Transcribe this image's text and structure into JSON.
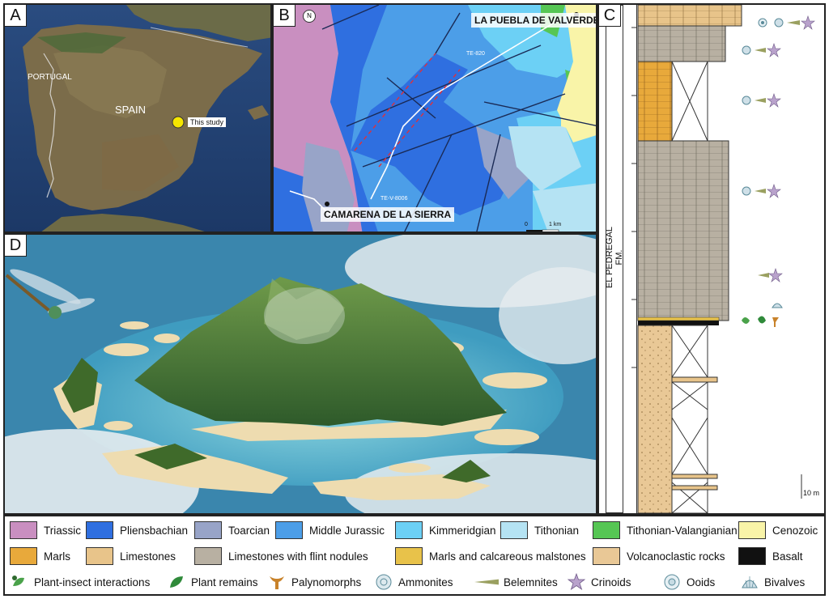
{
  "panels": {
    "a": {
      "label": "A",
      "country_1": "SPAIN",
      "country_2": "PORTUGAL",
      "marker": "This study"
    },
    "b": {
      "label": "B",
      "town_1": "LA PUEBLA DE VALVERDE",
      "town_2": "CAMARENA DE LA SIERRA",
      "road_1": "TE-820",
      "road_2": "TE-V-8006",
      "north": "N",
      "scale_0": "0",
      "scale_1": "1 km"
    },
    "c": {
      "label": "C",
      "formation": "EL PEDREGAL FM.",
      "scale": "10 m"
    },
    "d": {
      "label": "D"
    }
  },
  "legend": {
    "geology": [
      {
        "name": "Triassic",
        "color": "#c98fc0"
      },
      {
        "name": "Pliensbachian",
        "color": "#2f6fe0"
      },
      {
        "name": "Toarcian",
        "color": "#98a4c8"
      },
      {
        "name": "Middle Jurassic",
        "color": "#4c9ee8"
      },
      {
        "name": "Kimmeridgian",
        "color": "#6cd0f5"
      },
      {
        "name": "Tithonian",
        "color": "#b5e3f3"
      },
      {
        "name": "Tithonian-Valangianian",
        "color": "#56c654"
      },
      {
        "name": "Cenozoic",
        "color": "#f9f4a8"
      }
    ],
    "lithology": [
      {
        "name": "Marls",
        "color": "#e8a93b"
      },
      {
        "name": "Limestones",
        "color": "#e8c48a"
      },
      {
        "name": "Limestones with flint nodules",
        "color": "#b8b0a2"
      },
      {
        "name": "Marls and calcareous malstones",
        "color": "#e8c24a"
      },
      {
        "name": "Volcanoclastic rocks",
        "color": "#e9c896"
      },
      {
        "name": "Basalt",
        "color": "#111111"
      }
    ],
    "fossils": [
      {
        "name": "Plant-insect interactions",
        "icon": "plant-insect-icon"
      },
      {
        "name": "Plant remains",
        "icon": "leaf-icon"
      },
      {
        "name": "Palynomorphs",
        "icon": "palynomorph-icon"
      },
      {
        "name": "Ammonites",
        "icon": "ammonite-icon"
      },
      {
        "name": "Belemnites",
        "icon": "belemnite-icon"
      },
      {
        "name": "Crinoids",
        "icon": "crinoid-icon"
      },
      {
        "name": "Ooids",
        "icon": "ooid-icon"
      },
      {
        "name": "Bivalves",
        "icon": "bivalve-icon"
      }
    ]
  }
}
